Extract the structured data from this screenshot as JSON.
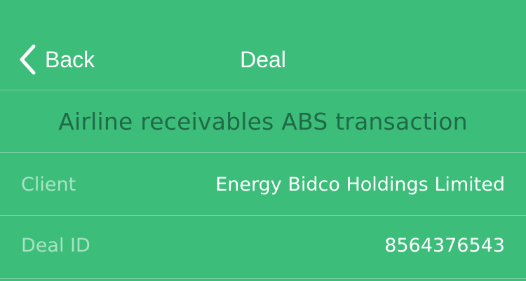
{
  "nav": {
    "back_label": "Back",
    "title": "Deal",
    "back_icon": "chevron-left-icon"
  },
  "deal": {
    "name": "Airline receivables ABS transaction"
  },
  "details": {
    "client_label": "Client",
    "client_value": "Energy Bidco Holdings Limited",
    "deal_id_label": "Deal ID",
    "deal_id_value": "8564376543"
  },
  "colors": {
    "background": "#3dbd7a",
    "deal_name_text": "#1f6a47",
    "label_text": "#a8e3c4",
    "value_text": "#ffffff"
  }
}
